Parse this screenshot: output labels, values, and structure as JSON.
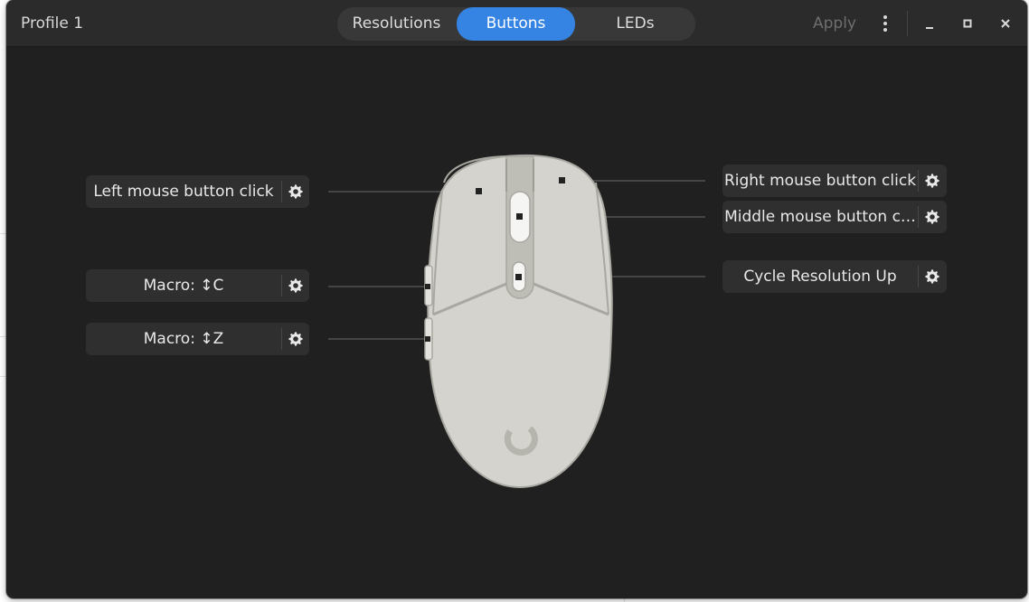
{
  "window": {
    "profile_title": "Profile 1",
    "apply_label": "Apply"
  },
  "tabs": [
    {
      "label": "Resolutions",
      "active": false
    },
    {
      "label": "Buttons",
      "active": true
    },
    {
      "label": "LEDs",
      "active": false
    }
  ],
  "window_controls": {
    "menu_icon": "vertical-dots-icon",
    "minimize_icon": "minimize-icon",
    "maximize_icon": "maximize-icon",
    "close_icon": "close-icon"
  },
  "mappings": {
    "left_click": "Left mouse button click",
    "macro_c": "Macro:  ↕C",
    "macro_z": "Macro:  ↕Z",
    "right_click": "Right mouse button click",
    "middle_click": "Middle mouse button c…",
    "cycle_resolution": "Cycle Resolution Up"
  },
  "colors": {
    "accent": "#3584e4",
    "window_bg": "#202020",
    "header_bg": "#2b2b2b",
    "mouse_body": "#d4d3cd"
  }
}
